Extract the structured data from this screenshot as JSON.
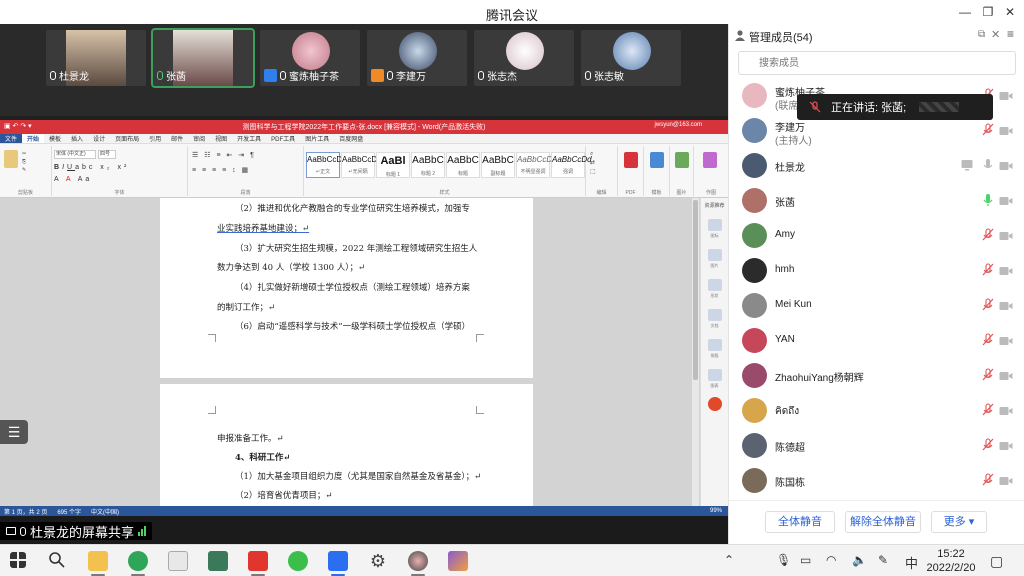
{
  "window": {
    "title": "腾讯会议"
  },
  "video_strip": {
    "tiles": [
      {
        "name": "杜景龙",
        "kind": "camera"
      },
      {
        "name": "张菡",
        "kind": "camera",
        "active": true
      },
      {
        "name": "蜜炼柚子茶",
        "kind": "avatar",
        "badge": "blue"
      },
      {
        "name": "李建万",
        "kind": "avatar",
        "badge": "orange"
      },
      {
        "name": "张志杰",
        "kind": "avatar"
      },
      {
        "name": "张志敏",
        "kind": "avatar"
      }
    ]
  },
  "word": {
    "title": "测图科学与工程学院2022年工作要点-张.docx [兼容模式] - Word(产品激活失败)",
    "account": "jwsyun@163.com",
    "tabs": [
      "文件",
      "开始",
      "模板",
      "插入",
      "设计",
      "页面布局",
      "引用",
      "邮件",
      "审阅",
      "视图",
      "开发工具",
      "PDF工具",
      "图片工具",
      "百度网盘"
    ],
    "ribbon_groups": [
      "剪贴板",
      "字体",
      "段落",
      "样式",
      "编辑",
      "PDF",
      "模板",
      "图片",
      "作图"
    ],
    "font_name": "宋体 (中文正)",
    "font_size": "四号",
    "styles": [
      {
        "preview": "AaBbCcDd",
        "name": "↵正文"
      },
      {
        "preview": "AaBbCcDd",
        "name": "↵无间隔"
      },
      {
        "preview": "AaBl",
        "name": "标题 1"
      },
      {
        "preview": "AaBbC",
        "name": "标题 2"
      },
      {
        "preview": "AaBbC",
        "name": "标题"
      },
      {
        "preview": "AaBbC",
        "name": "副标题"
      },
      {
        "preview": "AaBbCcDd",
        "name": "不明显强调"
      },
      {
        "preview": "AaBbCcDd",
        "name": "强调"
      }
    ],
    "page1_lines": [
      "（2）推进和优化产教融合的专业学位研究生培养模式，加强专",
      "业实践培养基地建设；↵",
      "（3）扩大研究生招生规模，2022 年测绘工程领域研究生招生人",
      "数力争达到 40 人（学校 1300 人）；↵",
      "（4）扎实做好新增硕士学位授权点（测绘工程领域）培养方案",
      "的制订工作；↵",
      "（6）启动“遥感科学与技术”一级学科硕士学位授权点（学硕）"
    ],
    "page2_lines": [
      "申报准备工作。↵",
      "4、科研工作↵",
      "（1）加大基金项目组织力度（尤其是国家自然基金及省基金）；↵",
      "（2）培育省优青项目；↵"
    ],
    "status": {
      "page": "第 1 页，共 2 页",
      "words": "695 个字",
      "lang": "中文(中国)",
      "zoom": "99%"
    },
    "side_pane": [
      "资源推荐",
      "图标",
      "图片",
      "形状",
      "文档",
      "排版",
      "图表",
      "素材"
    ]
  },
  "share": {
    "label": "杜景龙的屏幕共享"
  },
  "panel": {
    "title": "管理成员(54)",
    "search_placeholder": "搜索成员",
    "speaking_text": "正在讲话: 张菡;",
    "members": [
      {
        "name": "蜜炼柚子茶",
        "role": "(联席主持人)",
        "mic": "muted",
        "cam": "off",
        "av": "#e8b7c0"
      },
      {
        "name": "李建万",
        "role": "(主持人)",
        "mic": "muted",
        "cam": "off",
        "av": "#6b86a8"
      },
      {
        "name": "杜景龙",
        "role": "",
        "mic": "off",
        "cam": "off",
        "screen": true,
        "av": "#4a5a70"
      },
      {
        "name": "张菡",
        "role": "",
        "mic": "on",
        "cam": "off",
        "av": "#b0706a"
      },
      {
        "name": "Amy",
        "role": "",
        "mic": "muted",
        "cam": "off",
        "av": "#5a8f5a"
      },
      {
        "name": "hmh",
        "role": "",
        "mic": "muted",
        "cam": "off",
        "av": "#2b2b2b"
      },
      {
        "name": "Mei Kun",
        "role": "",
        "mic": "muted",
        "cam": "off",
        "av": "#8a8a8a"
      },
      {
        "name": "YAN",
        "role": "",
        "mic": "muted",
        "cam": "off",
        "av": "#c7475a"
      },
      {
        "name": "ZhaohuiYang杨朝辉",
        "role": "",
        "mic": "muted",
        "cam": "off",
        "av": "#9a4a6a"
      },
      {
        "name": "คิดถึง",
        "role": "",
        "mic": "muted",
        "cam": "off",
        "av": "#d7a64a"
      },
      {
        "name": "陈德超",
        "role": "",
        "mic": "muted",
        "cam": "off",
        "av": "#5b6270"
      },
      {
        "name": "陈国栋",
        "role": "",
        "mic": "muted",
        "cam": "off",
        "av": "#7a6a5a"
      }
    ],
    "buttons": {
      "mute_all": "全体静音",
      "unmute_all": "解除全体静音",
      "more": "更多 ▾"
    }
  },
  "taskbar": {
    "ime": "中",
    "time": "15:22",
    "date": "2022/2/20"
  },
  "colors": {
    "accent": "#2b63d9",
    "word_red": "#d6333b",
    "word_blue": "#2b579a",
    "mic_green": "#4cd26b",
    "mute_red": "#e25555"
  }
}
